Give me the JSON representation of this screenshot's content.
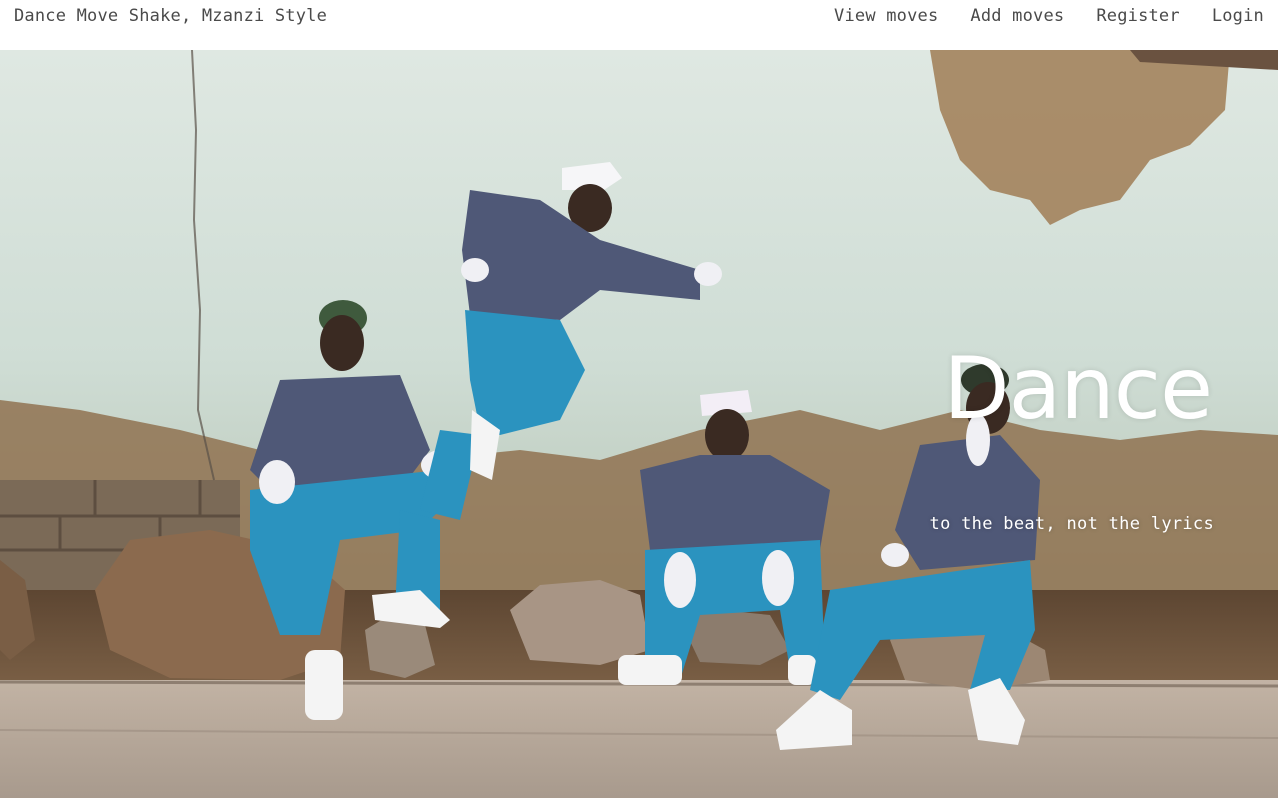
{
  "navbar": {
    "brand": "Dance Move Shake, Mzanzi Style",
    "links": [
      {
        "label": "View moves"
      },
      {
        "label": "Add moves"
      },
      {
        "label": "Register"
      },
      {
        "label": "Login"
      }
    ]
  },
  "hero": {
    "title": "Dance",
    "subtitle": "to the beat, not the lyrics",
    "image_subject": "four dancers in purple shirts, blue trousers, white gloves and caps posing in front of a weathered wall",
    "colors": {
      "wall": "#d4e0d8",
      "mud": "#8a6a45",
      "shirt": "#4f5877",
      "trousers": "#2b93bf",
      "ground": "#6b523b",
      "pavement": "#b9a898"
    }
  }
}
